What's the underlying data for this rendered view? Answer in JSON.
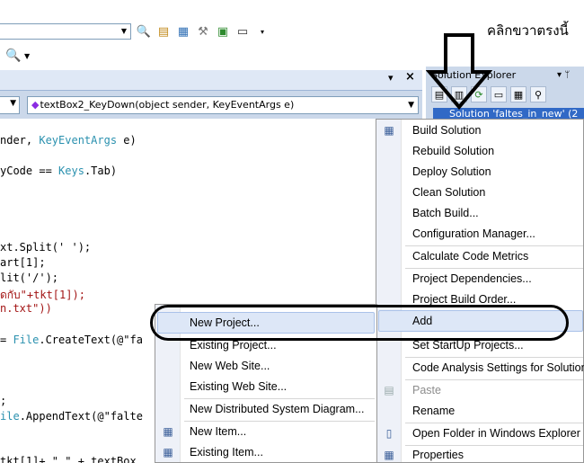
{
  "annotation": {
    "thai_text": "คลิกขวาตรงนี้"
  },
  "editor": {
    "method_combo": "textBox2_KeyDown(object sender, KeyEventArgs e)",
    "code_lines": [
      {
        "plain": "nder, ",
        "type": "KeyEventArgs",
        "rest": " e)"
      },
      {
        "plain": "yCode == ",
        "type": "Keys",
        "rest": ".Tab)"
      },
      {
        "plain": "xt.Split(' ');"
      },
      {
        "plain": "art[1];"
      },
      {
        "plain": "lit('/');"
      },
      {
        "plain": "",
        "str": "ดกับ\"+tkt[1]);"
      },
      {
        "plain": "",
        "str": "n.txt\"))"
      },
      {
        "plain": "= ",
        "type": "File",
        "rest": ".CreateText(@\"fa"
      },
      {
        "plain": ";"
      },
      {
        "plain": "",
        "type": "ile",
        "rest": ".AppendText(@\"falte"
      },
      {
        "plain": "tkt[1]+ \" \" + textBox"
      }
    ]
  },
  "solution_explorer": {
    "title": "Solution Explorer",
    "selected_item": "Solution 'faltes_in_new' (2"
  },
  "context_menu": {
    "items": [
      "Build Solution",
      "Rebuild Solution",
      "Deploy Solution",
      "Clean Solution",
      "Batch Build...",
      "Configuration Manager...",
      "Calculate Code Metrics",
      "Project Dependencies...",
      "Project Build Order...",
      "Add",
      "Set StartUp Projects...",
      "Code Analysis Settings for Solution",
      "Paste",
      "Rename",
      "Open Folder in Windows Explorer",
      "Properties"
    ]
  },
  "add_submenu": {
    "items": [
      "New Project...",
      "Existing Project...",
      "New Web Site...",
      "Existing Web Site...",
      "New Distributed System Diagram...",
      "New Item...",
      "Existing Item..."
    ]
  }
}
